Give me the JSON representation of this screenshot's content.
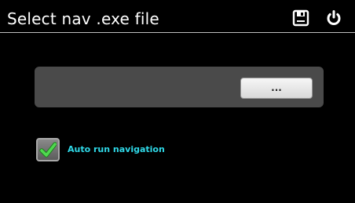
{
  "header": {
    "title": "Select nav .exe file",
    "save_icon": "save-icon",
    "power_icon": "power-icon"
  },
  "file_selector": {
    "path_value": "",
    "browse_label": "..."
  },
  "options": {
    "auto_run": {
      "label": "Auto run navigation",
      "checked": true,
      "check_icon": "checkmark-icon"
    }
  },
  "colors": {
    "background": "#000000",
    "title_text": "#ffffff",
    "panel": "#4a4a4a",
    "label_accent": "#2fd9e8",
    "check_green": "#3cc63c"
  }
}
